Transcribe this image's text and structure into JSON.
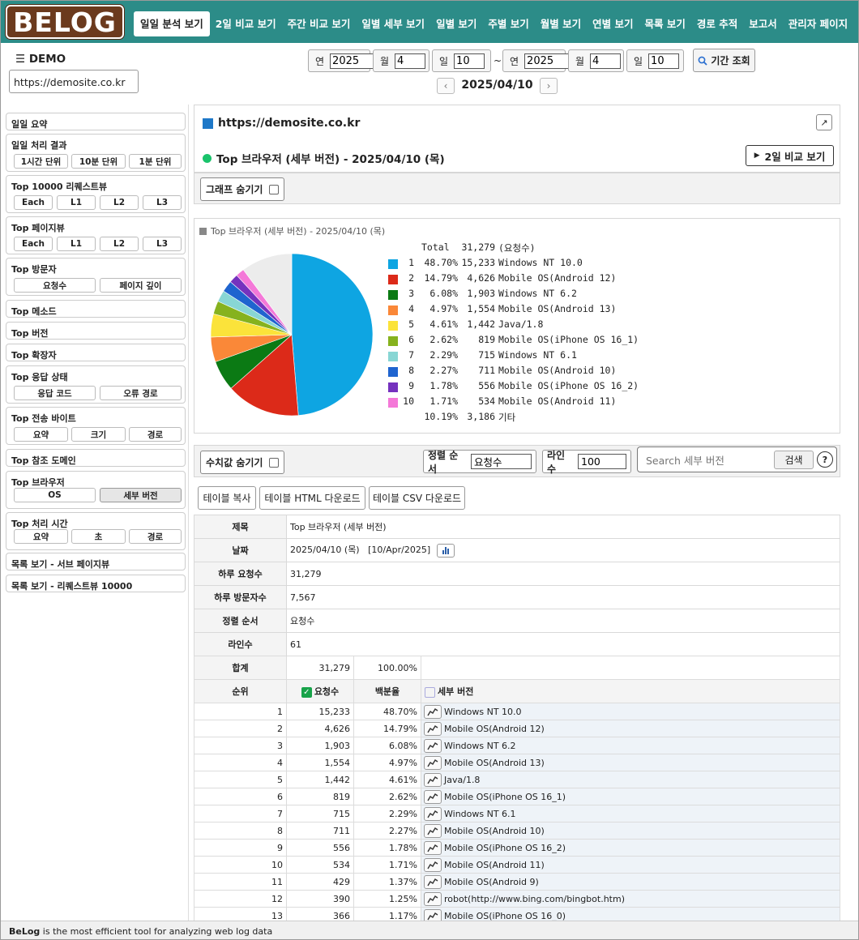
{
  "logo_text": "BELOG",
  "nav": [
    "일일 분석 보기",
    "2일 비교 보기",
    "주간 비교 보기",
    "일별 세부 보기",
    "일별 보기",
    "주별 보기",
    "월별 보기",
    "연별 보기",
    "목록 보기",
    "경로 추적",
    "보고서",
    "관리자 페이지"
  ],
  "header": {
    "menu_title": "DEMO",
    "site_value": "https://demosite.co.kr",
    "from": {
      "year_label": "연",
      "year": "2025",
      "month_label": "월",
      "month": "4",
      "day_label": "일",
      "day": "10"
    },
    "to": {
      "year_label": "연",
      "year": "2025",
      "month_label": "월",
      "month": "4",
      "day_label": "일",
      "day": "10"
    },
    "tilde": "~",
    "period_button": "기간 조회",
    "current_date": "2025/04/10"
  },
  "sidebar": {
    "daily_summary": "일일 요약",
    "daily_result": {
      "title": "일일 처리 결과",
      "buttons": [
        "1시간 단위",
        "10분 단위",
        "1분 단위"
      ]
    },
    "top_requests": {
      "title": "Top 10000 리퀘스트뷰",
      "buttons": [
        "Each",
        "L1",
        "L2",
        "L3"
      ]
    },
    "top_pageview": {
      "title": "Top 페이지뷰",
      "buttons": [
        "Each",
        "L1",
        "L2",
        "L3"
      ]
    },
    "top_visitor": {
      "title": "Top 방문자",
      "buttons": [
        "요청수",
        "페이지 깊이"
      ]
    },
    "top_method": "Top 메소드",
    "top_version": "Top 버전",
    "top_ext": "Top 확장자",
    "top_status": {
      "title": "Top 응답 상태",
      "buttons": [
        "응답 코드",
        "오류 경로"
      ]
    },
    "top_bytes": {
      "title": "Top 전송 바이트",
      "buttons": [
        "요약",
        "크기",
        "경로"
      ]
    },
    "top_ref": "Top 참조 도메인",
    "top_browser": {
      "title": "Top 브라우저",
      "buttons": [
        "OS",
        "세부 버전"
      ]
    },
    "top_time": {
      "title": "Top 처리 시간",
      "buttons": [
        "요약",
        "초",
        "경로"
      ]
    },
    "list_sub": "목록 보기 - 서브 페이지뷰",
    "list_req": "목록 보기 - 리퀘스트뷰 10000"
  },
  "main": {
    "site_url": "https://demosite.co.kr",
    "ext_icon": "↗",
    "section_title": "Top 브라우저 (세부 버전) - 2025/04/10 (목)",
    "compare_button": "2일 비교 보기",
    "hide_graph": "그래프 숨기기",
    "chart_caption": "Top 브라우저 (세부 버전) - 2025/04/10 (목)",
    "hide_values": "수치값 숨기기",
    "sort_label": "정렬 순서",
    "sort_value": "요청수",
    "lines_label": "라인수",
    "lines_value": "100",
    "search_placeholder": "Search 세부 버전",
    "search_button": "검색",
    "help": "?",
    "table_buttons": [
      "테이블 복사",
      "테이블 HTML 다운로드",
      "테이블 CSV 다운로드"
    ]
  },
  "chart_data": {
    "type": "pie",
    "title": "Top 브라우저 (세부 버전) - 2025/04/10 (목)",
    "total_label": "Total",
    "total_value": "31,279",
    "total_unit": "(요청수)",
    "slices": [
      {
        "rank": "1",
        "pct": "48.70%",
        "count": "15,233",
        "name": "Windows NT 10.0",
        "value": 48.7,
        "color": "#0ea5e2"
      },
      {
        "rank": "2",
        "pct": "14.79%",
        "count": "4,626",
        "name": "Mobile OS(Android 12)",
        "value": 14.79,
        "color": "#dc2a19"
      },
      {
        "rank": "3",
        "pct": "6.08%",
        "count": "1,903",
        "name": "Windows NT 6.2",
        "value": 6.08,
        "color": "#0b7a14"
      },
      {
        "rank": "4",
        "pct": "4.97%",
        "count": "1,554",
        "name": "Mobile OS(Android 13)",
        "value": 4.97,
        "color": "#fa8838"
      },
      {
        "rank": "5",
        "pct": "4.61%",
        "count": "1,442",
        "name": "Java/1.8",
        "value": 4.61,
        "color": "#fbe33a"
      },
      {
        "rank": "6",
        "pct": "2.62%",
        "count": "819",
        "name": "Mobile OS(iPhone OS 16_1)",
        "value": 2.62,
        "color": "#86b21e"
      },
      {
        "rank": "7",
        "pct": "2.29%",
        "count": "715",
        "name": "Windows NT 6.1",
        "value": 2.29,
        "color": "#88d6d4"
      },
      {
        "rank": "8",
        "pct": "2.27%",
        "count": "711",
        "name": "Mobile OS(Android 10)",
        "value": 2.27,
        "color": "#1f64cf"
      },
      {
        "rank": "9",
        "pct": "1.78%",
        "count": "556",
        "name": "Mobile OS(iPhone OS 16_2)",
        "value": 1.78,
        "color": "#7532be"
      },
      {
        "rank": "10",
        "pct": "1.71%",
        "count": "534",
        "name": "Mobile OS(Android 11)",
        "value": 1.71,
        "color": "#f478d8"
      },
      {
        "rank": "",
        "pct": "10.19%",
        "count": "3,186",
        "name": "기타",
        "value": 10.19,
        "color": "#ececec"
      }
    ]
  },
  "info_table": {
    "title_k": "제목",
    "title_v": "Top 브라우저 (세부 버전)",
    "date_k": "날짜",
    "date_v": "2025/04/10 (목)   [10/Apr/2025]",
    "req_k": "하루 요청수",
    "req_v": "31,279",
    "vis_k": "하루 방문자수",
    "vis_v": "7,567",
    "sort_k": "정렬 순서",
    "sort_v": "요청수",
    "lines_k": "라인수",
    "lines_v": "61"
  },
  "data_table": {
    "sum_label": "합계",
    "sum_count": "31,279",
    "sum_pct": "100.00%",
    "h_rank": "순위",
    "h_count": "요청수",
    "h_pct": "백분율",
    "h_name": "세부 버전",
    "rows": [
      {
        "rank": "1",
        "count": "15,233",
        "pct": "48.70%",
        "name": "Windows NT 10.0"
      },
      {
        "rank": "2",
        "count": "4,626",
        "pct": "14.79%",
        "name": "Mobile OS(Android 12)"
      },
      {
        "rank": "3",
        "count": "1,903",
        "pct": "6.08%",
        "name": "Windows NT 6.2"
      },
      {
        "rank": "4",
        "count": "1,554",
        "pct": "4.97%",
        "name": "Mobile OS(Android 13)"
      },
      {
        "rank": "5",
        "count": "1,442",
        "pct": "4.61%",
        "name": "Java/1.8"
      },
      {
        "rank": "6",
        "count": "819",
        "pct": "2.62%",
        "name": "Mobile OS(iPhone OS 16_1)"
      },
      {
        "rank": "7",
        "count": "715",
        "pct": "2.29%",
        "name": "Windows NT 6.1"
      },
      {
        "rank": "8",
        "count": "711",
        "pct": "2.27%",
        "name": "Mobile OS(Android 10)"
      },
      {
        "rank": "9",
        "count": "556",
        "pct": "1.78%",
        "name": "Mobile OS(iPhone OS 16_2)"
      },
      {
        "rank": "10",
        "count": "534",
        "pct": "1.71%",
        "name": "Mobile OS(Android 11)"
      },
      {
        "rank": "11",
        "count": "429",
        "pct": "1.37%",
        "name": "Mobile OS(Android 9)"
      },
      {
        "rank": "12",
        "count": "390",
        "pct": "1.25%",
        "name": "robot(http://www.bing.com/bingbot.htm)"
      },
      {
        "rank": "13",
        "count": "366",
        "pct": "1.17%",
        "name": "Mobile OS(iPhone OS 16_0)"
      }
    ]
  },
  "footer": {
    "brand": "BeLog",
    "text": " is the most efficient tool for analyzing web log data"
  }
}
